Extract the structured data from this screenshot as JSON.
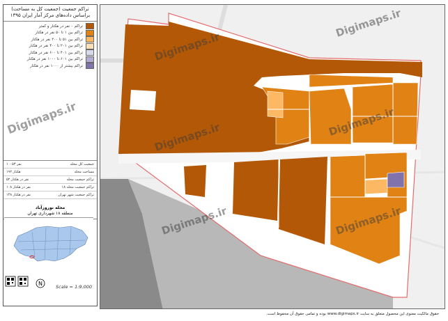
{
  "legend": {
    "title_line1": "تراکم جمعیت (جمعیت کل به مساحت)",
    "title_line2": "براساس داده‌های مرکز آمار ایران ۱۳۹۵",
    "classes": [
      {
        "label": "تراکم ۰ نفر در هکتار و کمتر",
        "color": "#b35806"
      },
      {
        "label": "تراکم بین ۱ تا ۵۰ نفر در هکتار",
        "color": "#e08214"
      },
      {
        "label": "تراکم بین ۵۱ تا ۲۰۰ نفر در هکتار",
        "color": "#fdb863"
      },
      {
        "label": "تراکم بین ۲۰۱ تا ۴۰۰ نفر در هکتار",
        "color": "#fee0b6"
      },
      {
        "label": "تراکم بین ۴۰۱ تا ۶۰۰ نفر در هکتار",
        "color": "#d8daeb"
      },
      {
        "label": "تراکم بین ۶۰۱ تا ۱۰۰۰ نفر در هکتار",
        "color": "#b2abd2"
      },
      {
        "label": "تراکم بیشتر از ۱۰۰۰ نفر در هکتار",
        "color": "#8073ac"
      }
    ],
    "stats": [
      {
        "label": "جمعیت کل محله",
        "value": "۱۰۰۵۳ نفر"
      },
      {
        "label": "مساحت محله",
        "value": "۱۹۲ هکتار"
      },
      {
        "label": "تراکم جمعیت محله",
        "value": "۵۲ نفر در هکتار"
      },
      {
        "label": "تراکم جمعیت محله ۱۸",
        "value": "۱۰۸ نفر در هکتار"
      },
      {
        "label": "تراکم جمعیت شهر تهران",
        "value": "۱۴۸ نفر در هکتار"
      }
    ],
    "place_line1": "محله نوروزآباد",
    "place_line2": "منطقه ۱۸ شهرداری تهران",
    "scale": "Scale = 1:9,000"
  },
  "watermark": "Digimaps.ir",
  "footer": "حقوق مالکیت معنوی این محصول متعلق به سایت www.digimaps.ir بوده و تمامی حقوق آن محفوظ است."
}
